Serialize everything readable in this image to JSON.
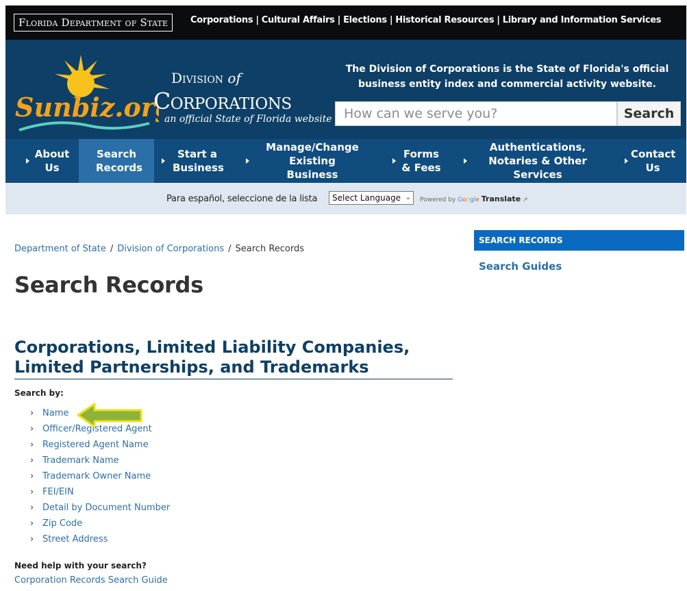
{
  "topbar": {
    "dept_logo": "Florida Department of State",
    "links": [
      "Corporations",
      "Cultural Affairs",
      "Elections",
      "Historical Resources",
      "Library and Information Services"
    ]
  },
  "header": {
    "logo_text": "Sunbiz.org",
    "division_word": "Division",
    "of_word": "of",
    "corporations_word": "Corporations",
    "official_line": "an official State of Florida website",
    "tagline": "The Division of Corporations is the State of Florida's official business entity index and commercial activity website.",
    "search_placeholder": "How can we serve you?",
    "search_button": "Search"
  },
  "nav": {
    "items": [
      {
        "label": "About Us",
        "active": false
      },
      {
        "label": "Search Records",
        "active": true
      },
      {
        "label": "Start a Business",
        "active": false
      },
      {
        "label": "Manage/Change Existing Business",
        "active": false
      },
      {
        "label": "Forms & Fees",
        "active": false
      },
      {
        "label": "Authentications, Notaries & Other Services",
        "active": false
      },
      {
        "label": "Contact Us",
        "active": false
      }
    ]
  },
  "translate": {
    "prompt": "Para español, seleccione de la lista",
    "select_value": "Select Language",
    "powered_by": "Powered by",
    "google": "Google",
    "translate_label": "Translate"
  },
  "breadcrumb": {
    "items": [
      "Department of State",
      "Division of Corporations"
    ],
    "current": "Search Records"
  },
  "main": {
    "title": "Search Records",
    "section_title": "Corporations, Limited Liability Companies, Limited Partnerships, and Trademarks",
    "search_by_label": "Search by:",
    "search_links": [
      "Name",
      "Officer/Registered Agent",
      "Registered Agent Name",
      "Trademark Name",
      "Trademark Owner Name",
      "FEI/EIN",
      "Detail by Document Number",
      "Zip Code",
      "Street Address"
    ],
    "help_label": "Need help with your search?",
    "guide_link": "Corporation Records Search Guide"
  },
  "sidebar": {
    "heading": "SEARCH RECORDS",
    "link": "Search Guides"
  },
  "colors": {
    "header_bg": "#0e3f66",
    "nav_bg": "#104c7e",
    "nav_active": "#2a6fa8",
    "link": "#2b6ea6",
    "sidebar_head": "#0a6ac0",
    "arrow_fill": "#8db33a"
  },
  "icons": {
    "list_bullet": "chevron-right-icon",
    "nav_bullet": "caret-right-icon",
    "pointer": "arrow-left-icon"
  }
}
